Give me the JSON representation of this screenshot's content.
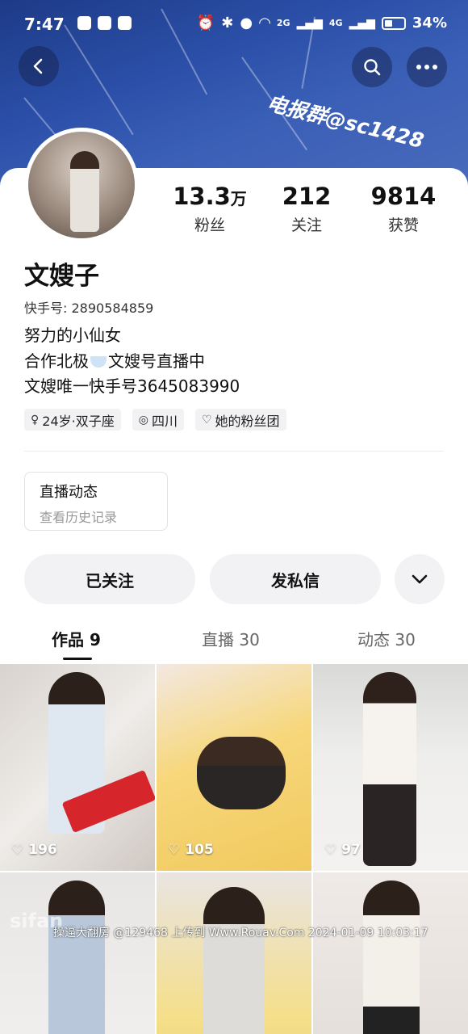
{
  "status_bar": {
    "time": "7:47",
    "signal_labels": [
      "2G",
      "4G"
    ],
    "battery": "34%"
  },
  "watermark": "电报群@sc1428",
  "profile": {
    "stats": [
      {
        "value": "13.3",
        "unit": "万",
        "label": "粉丝"
      },
      {
        "value": "212",
        "unit": "",
        "label": "关注"
      },
      {
        "value": "9814",
        "unit": "",
        "label": "获赞"
      }
    ],
    "name": "文嫂子",
    "kuaishou_id_label": "快手号:",
    "kuaishou_id": "2890584859",
    "bio_lines": [
      "努力的小仙女",
      "合作北极",
      "文嫂号直播中",
      "文嫂唯一快手号3645083990"
    ],
    "tags": [
      {
        "icon": "female-icon",
        "label": "24岁·双子座"
      },
      {
        "icon": "location-icon",
        "label": "四川"
      },
      {
        "icon": "heart-icon",
        "label": "她的粉丝团"
      }
    ]
  },
  "live_card": {
    "title": "直播动态",
    "subtitle": "查看历史记录"
  },
  "actions": {
    "follow": "已关注",
    "message": "发私信"
  },
  "tabs": [
    {
      "label": "作品 9",
      "active": true
    },
    {
      "label": "直播 30",
      "active": false
    },
    {
      "label": "动态 30",
      "active": false
    }
  ],
  "grid": [
    {
      "likes": "196"
    },
    {
      "likes": "105"
    },
    {
      "likes": "97"
    },
    {
      "likes": ""
    },
    {
      "likes": ""
    },
    {
      "likes": ""
    }
  ],
  "footer_watermark": "操逼大翻房 @129468 上传到 Www.Rouav.Com 2024-01-09 10:03:17",
  "side_watermark": "sifan"
}
